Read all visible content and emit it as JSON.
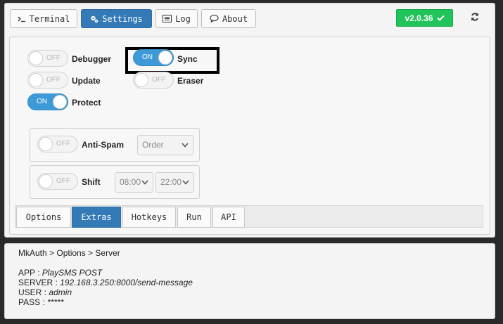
{
  "colors": {
    "accent": "#337ab7",
    "version_badge": "#21c45a",
    "toggle_on": "#3e9ad6",
    "background": "#2a2a2a"
  },
  "tabs": [
    {
      "label": "Terminal",
      "icon": "terminal-icon",
      "active": false
    },
    {
      "label": "Settings",
      "icon": "gears-icon",
      "active": true
    },
    {
      "label": "Log",
      "icon": "list-icon",
      "active": false
    },
    {
      "label": "About",
      "icon": "comment-icon",
      "active": false
    }
  ],
  "version": {
    "label": "v2.0.36",
    "icon": "check-icon"
  },
  "refresh_icon": "refresh-icon",
  "settings": {
    "debugger": {
      "label": "Debugger",
      "state": "OFF"
    },
    "update": {
      "label": "Update",
      "state": "OFF"
    },
    "protect": {
      "label": "Protect",
      "state": "ON"
    },
    "sync": {
      "label": "Sync",
      "state": "ON"
    },
    "eraser": {
      "label": "Eraser",
      "state": "OFF"
    },
    "anti_spam": {
      "label": "Anti-Spam",
      "state": "OFF",
      "select_value": "Order"
    },
    "shift": {
      "label": "Shift",
      "state": "OFF",
      "start": "08:00",
      "end": "22:00"
    }
  },
  "subtabs": [
    {
      "label": "Options",
      "active": false
    },
    {
      "label": "Extras",
      "active": true
    },
    {
      "label": "Hotkeys",
      "active": false
    },
    {
      "label": "Run",
      "active": false
    },
    {
      "label": "API",
      "active": false
    }
  ],
  "info": {
    "breadcrumb": "MkAuth > Options > Server",
    "app_key": "APP : ",
    "app_value": "PlaySMS POST",
    "server_key": "SERVER : ",
    "server_value": "192.168.3.250:8000/send-message",
    "user_key": "USER : ",
    "user_value": "admin",
    "pass_key": "PASS : ",
    "pass_value": "*****"
  }
}
